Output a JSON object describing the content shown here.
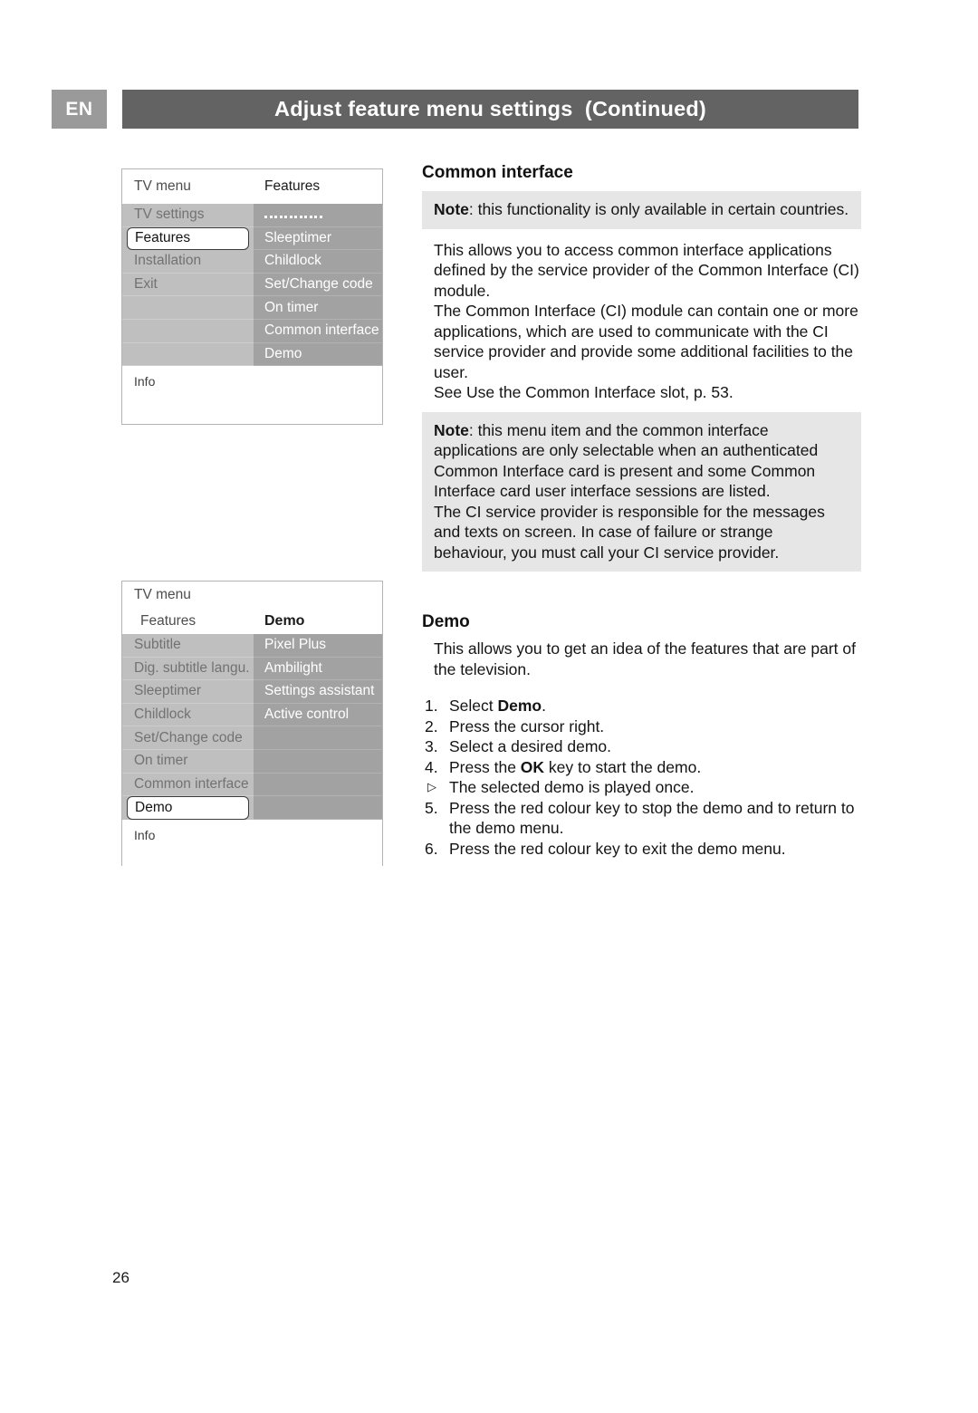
{
  "header": {
    "language_badge": "EN",
    "title": "Adjust feature menu settings  (Continued)"
  },
  "page_number": "26",
  "tv_menu_1": {
    "header_left": "TV menu",
    "header_right": "Features",
    "left_items": [
      "TV settings",
      "Features",
      "Installation",
      "Exit",
      "",
      "",
      ""
    ],
    "left_selected_index": 1,
    "right_items": [
      "",
      "Sleeptimer",
      "Childlock",
      "Set/Change code",
      "On timer",
      "Common interface",
      "Demo"
    ],
    "right_dots_index": 0,
    "footer": "Info"
  },
  "tv_menu_2": {
    "header_top": "TV menu",
    "header_left": "Features",
    "header_right": "Demo",
    "left_items": [
      "Subtitle",
      "Dig. subtitle langu.",
      "Sleeptimer",
      "Childlock",
      "Set/Change code",
      "On timer",
      "Common interface",
      "Demo"
    ],
    "left_selected_index": 7,
    "right_items": [
      "Pixel Plus",
      "Ambilight",
      "Settings assistant",
      "Active control",
      "",
      "",
      "",
      ""
    ],
    "footer": "Info"
  },
  "common_interface": {
    "title": "Common interface",
    "note_1_label": "Note",
    "note_1_text": ": this functionality is only available in certain countries.",
    "body": "This allows you to access common interface applications defined by the service provider of the Common Interface (CI) module.\nThe Common Interface (CI) module can contain one or more applications, which are used to communicate with the CI service provider and provide some additional facilities to the user.\nSee Use the Common Interface slot, p. 53.",
    "note_2_label": "Note",
    "note_2_text": ": this menu item and the common interface applications are only selectable when an authenticated Common Interface card is present and some Common Interface card user interface sessions are listed.\nThe CI service provider is responsible for the messages and texts on screen. In case of failure or strange behaviour, you must call your CI service provider."
  },
  "demo": {
    "title": "Demo",
    "intro": "This allows you to get an idea of the features that are part of the television.",
    "steps": [
      {
        "marker": "1.",
        "text_pre": "Select ",
        "bold": "Demo",
        "text_post": "."
      },
      {
        "marker": "2.",
        "text_pre": "Press the cursor right.",
        "bold": "",
        "text_post": ""
      },
      {
        "marker": "3.",
        "text_pre": "Select a desired demo.",
        "bold": "",
        "text_post": ""
      },
      {
        "marker": "4.",
        "text_pre": "Press the ",
        "bold": "OK",
        "text_post": " key to start the demo."
      },
      {
        "marker": "▷",
        "text_pre": "The selected demo is played once.",
        "bold": "",
        "text_post": ""
      },
      {
        "marker": "5.",
        "text_pre": "Press the red colour key to stop the demo and to return to the demo menu.",
        "bold": "",
        "text_post": ""
      },
      {
        "marker": "6.",
        "text_pre": "Press the red colour key to exit the demo menu.",
        "bold": "",
        "text_post": ""
      }
    ]
  },
  "colors": {
    "header_bar": "#636363",
    "badge": "#9a9a9a",
    "note_bg": "#e6e6e6",
    "menu_left_col": "#bfbfbf",
    "menu_right_col": "#a2a2a2"
  }
}
